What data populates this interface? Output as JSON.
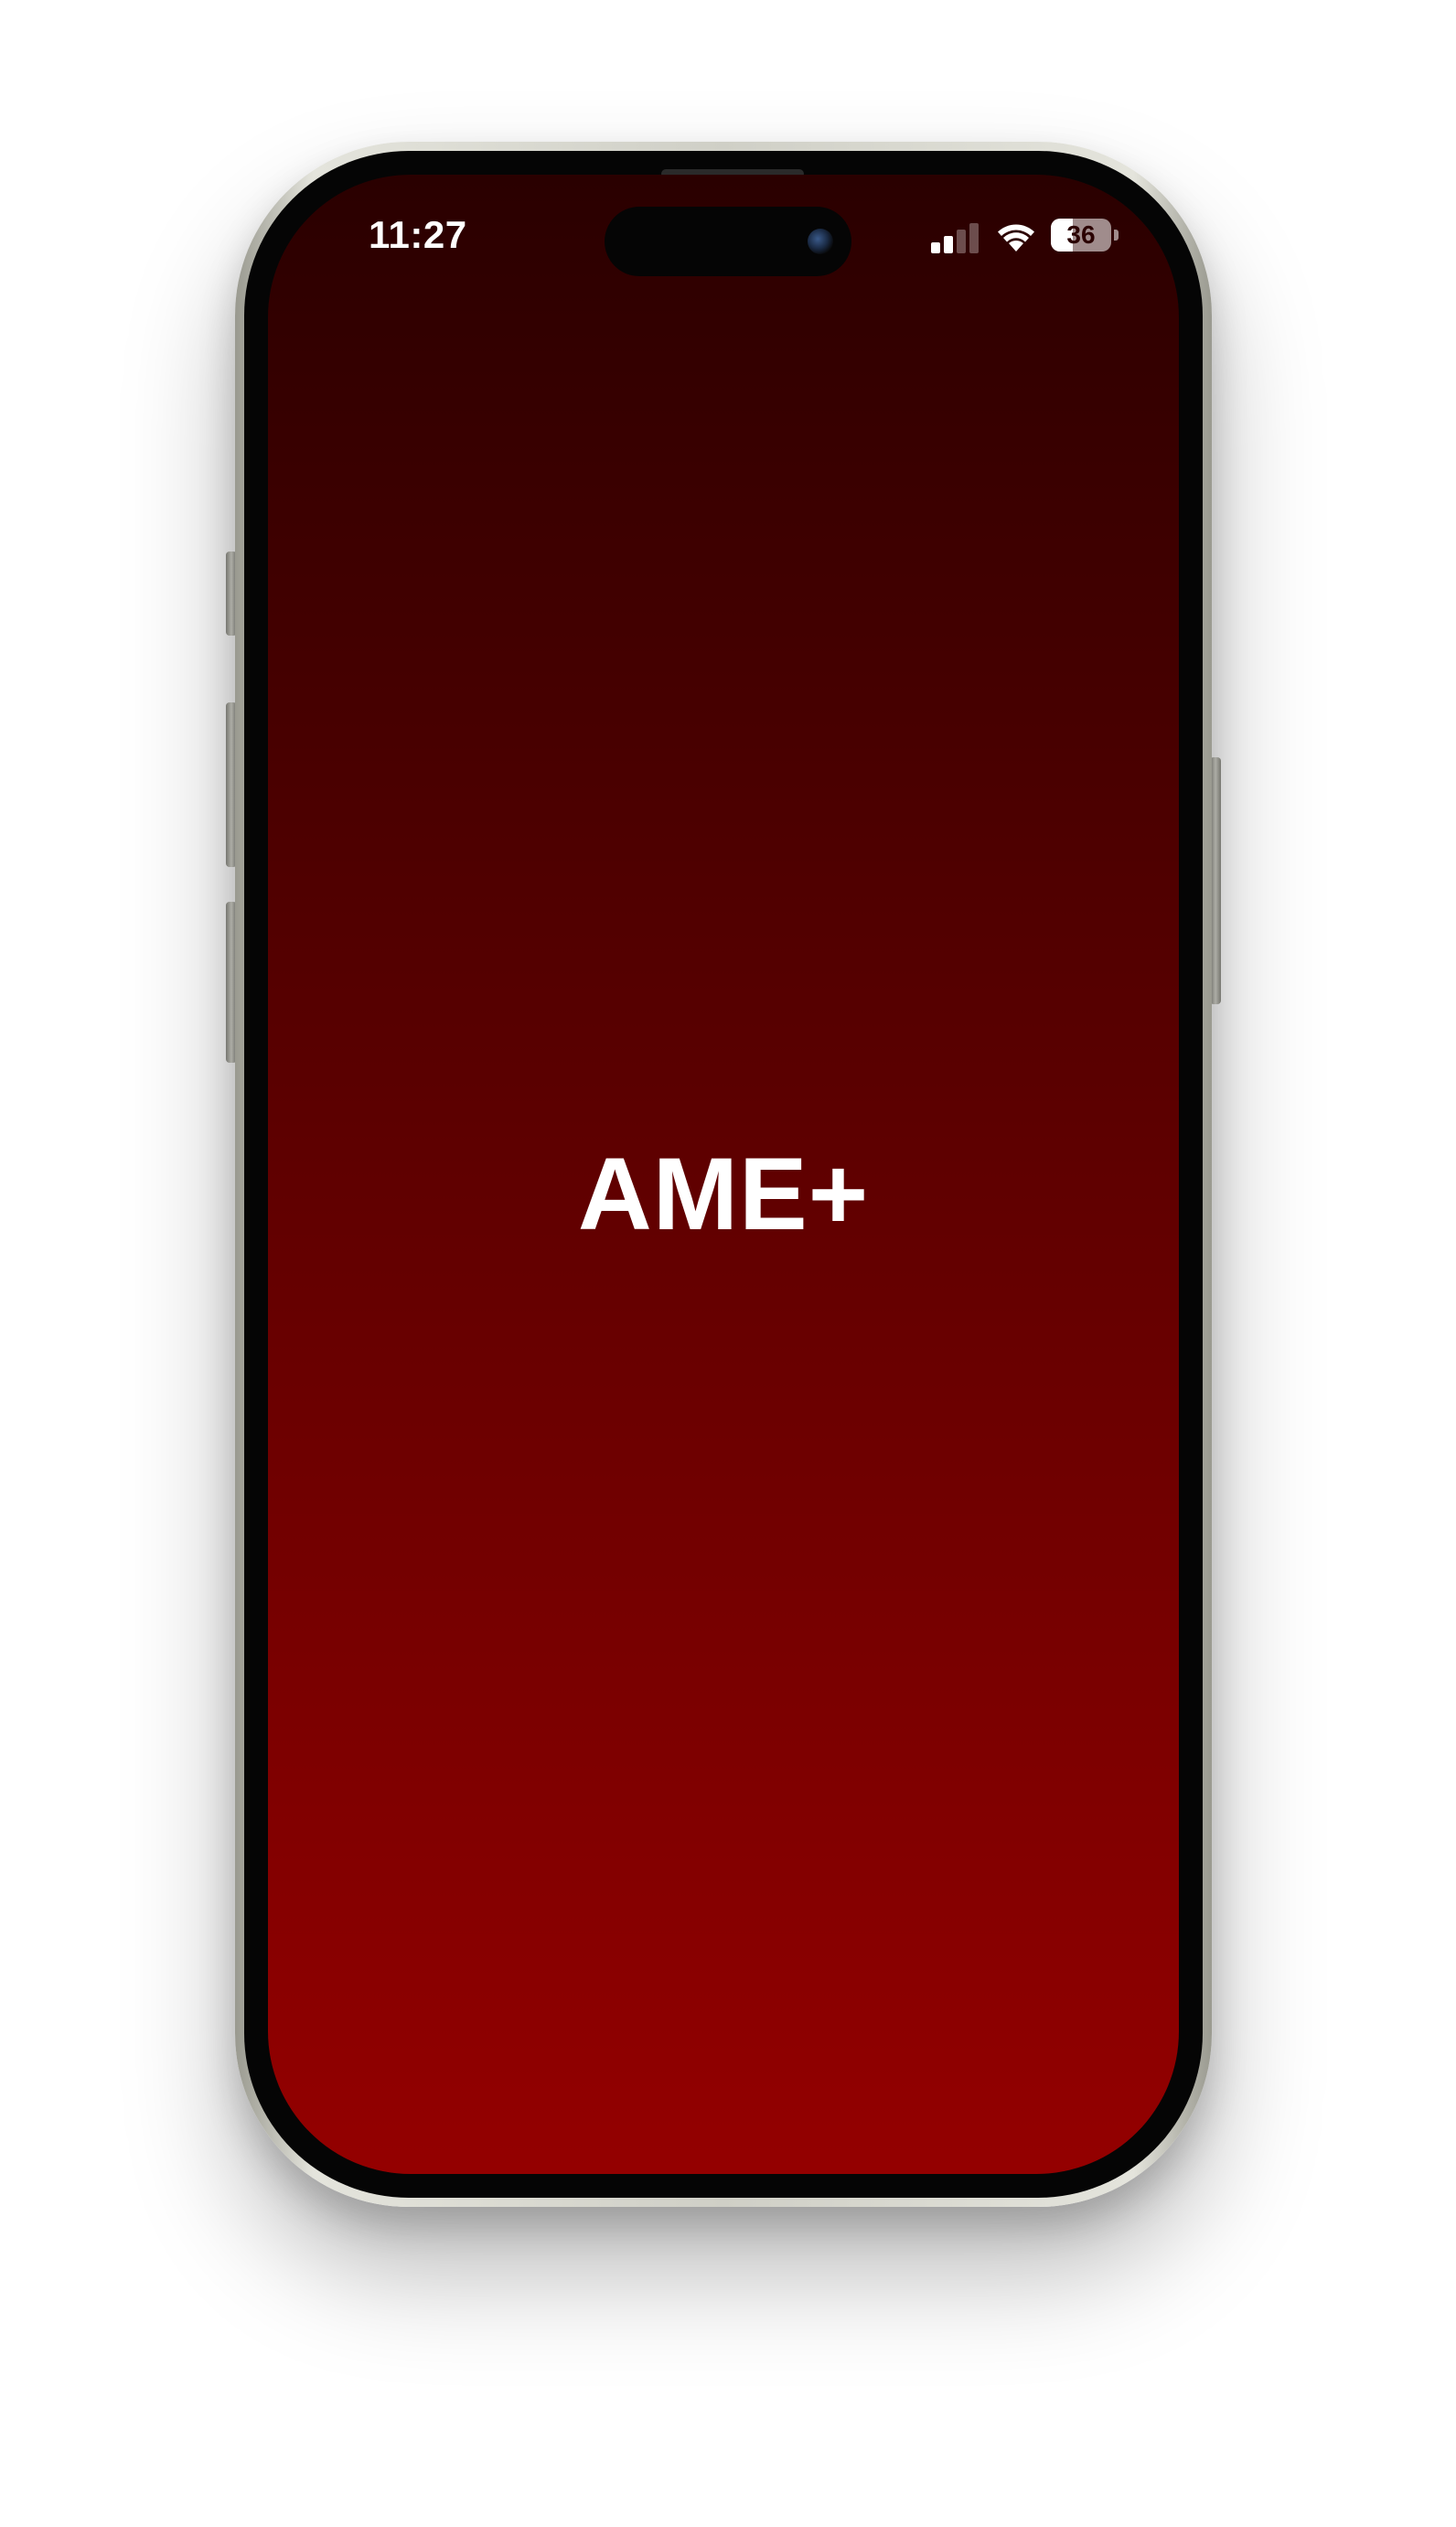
{
  "status_bar": {
    "time": "11:27",
    "battery_level": "36",
    "signal_bars_active": 2,
    "signal_bars_total": 4
  },
  "app": {
    "title": "AME+"
  },
  "icons": {
    "signal": "cellular-signal-icon",
    "wifi": "wifi-icon",
    "battery": "battery-icon",
    "camera": "front-camera-icon"
  },
  "colors": {
    "gradient_top": "#2a0000",
    "gradient_bottom": "#940000",
    "text": "#ffffff"
  }
}
